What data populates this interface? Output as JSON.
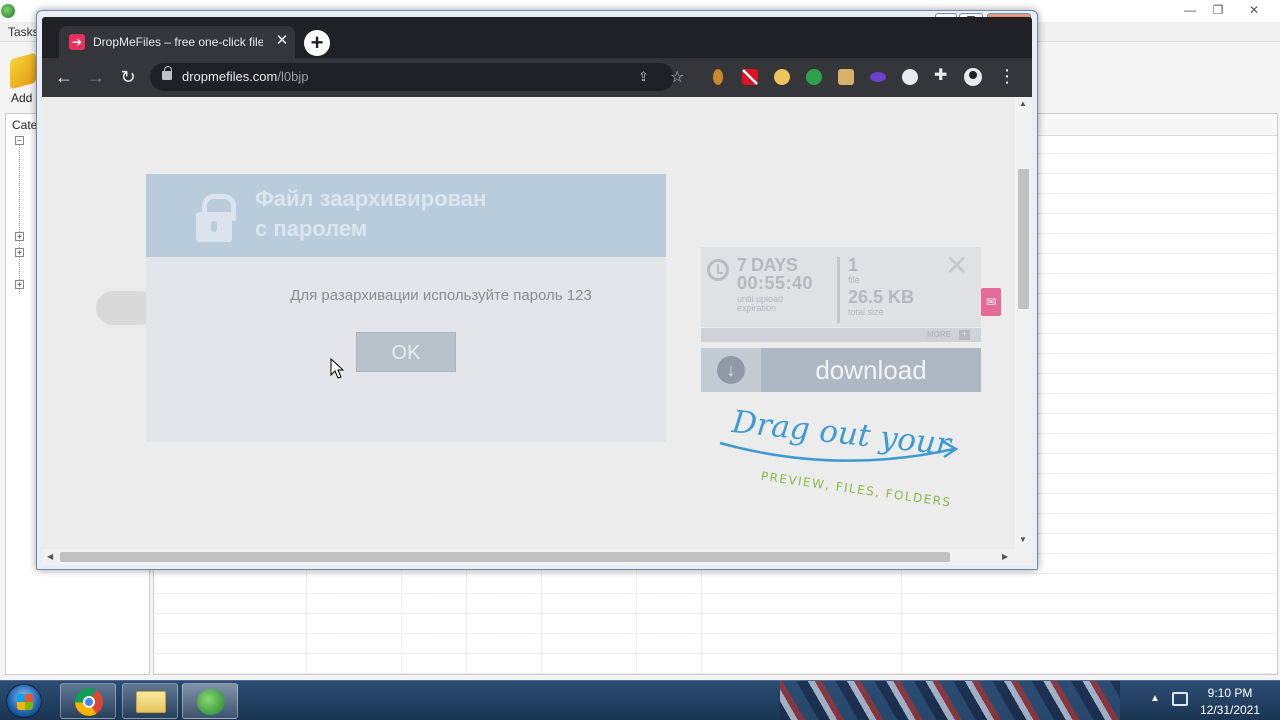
{
  "background_app": {
    "menu_tasks": "Tasks",
    "add_label": "Add U",
    "categories_label": "Cate"
  },
  "browser": {
    "tab_title": "DropMeFiles – free one-click file",
    "url_host": "dropmefiles.com",
    "url_path": "/l0bjp",
    "new_tab_symbol": "+",
    "tab_close_symbol": "✕"
  },
  "dialog": {
    "title_line1": "Файл заархивирован",
    "title_line2": "с паролем",
    "message": "Для разархивации используйте пароль 123",
    "ok_label": "OK"
  },
  "file_info": {
    "days": "7 DAYS",
    "time_left": "00:55:40",
    "until_line1": "until upload",
    "until_line2": "expiration",
    "file_count": "1",
    "file_label": "file",
    "total_size": "26.5 KB",
    "size_label": "total size",
    "more_label": "MORE",
    "more_symbol": "+",
    "download_label": "download"
  },
  "promo": {
    "headline": "Drag out your",
    "subline": "PREVIEW, FILES, FOLDERS"
  },
  "taskbar": {
    "time": "9:10 PM",
    "date": "12/31/2021"
  },
  "colors": {
    "tab_favicon": "#e8315f",
    "promo_blue": "#3f9ad0",
    "promo_green": "#8ab84a"
  }
}
